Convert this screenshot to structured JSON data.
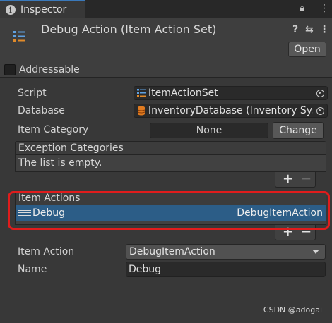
{
  "tab": {
    "label": "Inspector",
    "lock_glyph": "🔒︎",
    "menu_glyph": "⋮"
  },
  "header": {
    "title": "Debug Action (Item Action Set)",
    "help_glyph": "?",
    "preset_glyph": "⇆",
    "menu_glyph": "⋮",
    "open_label": "Open"
  },
  "addressable": {
    "label": "Addressable",
    "checked": false
  },
  "fields": {
    "script": {
      "label": "Script",
      "value": "ItemActionSet"
    },
    "database": {
      "label": "Database",
      "value": "InventoryDatabase (Inventory Sys"
    },
    "item_category": {
      "label": "Item Category",
      "value": "None",
      "button": "Change"
    }
  },
  "exception_categories": {
    "header": "Exception Categories",
    "empty_text": "The list is empty.",
    "add_glyph": "+",
    "remove_glyph": "−"
  },
  "item_actions": {
    "header": "Item Actions",
    "rows": [
      {
        "name": "Debug",
        "type": "DebugItemAction"
      }
    ],
    "add_glyph": "+",
    "remove_glyph": "−"
  },
  "item_action": {
    "label": "Item Action",
    "value": "DebugItemAction"
  },
  "name": {
    "label": "Name",
    "value": "Debug"
  },
  "watermark": "CSDN @adogai",
  "colors": {
    "selection": "#2c5d87",
    "highlight_border": "#e01c1c",
    "tab_accent": "#3a79bb",
    "database_icon": "#e07b20",
    "script_icon_blue": "#5fa0e0",
    "script_icon_orange": "#e08a2a"
  }
}
